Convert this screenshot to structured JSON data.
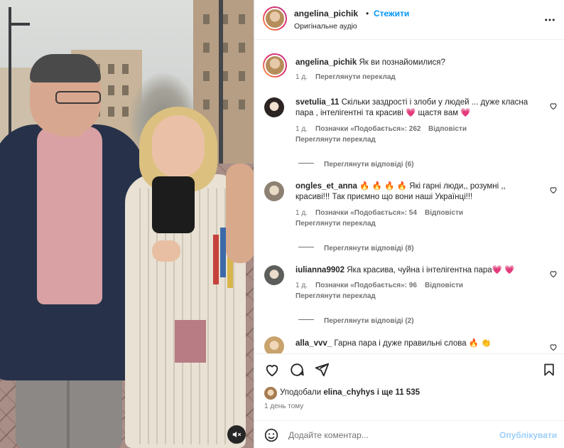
{
  "post_header": {
    "username": "angelina_pichik",
    "separator": "•",
    "follow_label": "Стежити",
    "audio_label": "Оригінальне аудіо",
    "more_icon": "more-horizontal-icon"
  },
  "caption": {
    "username": "angelina_pichik",
    "text": "Як ви познайомилися?",
    "time": "1 д.",
    "translate_label": "Переглянути переклад"
  },
  "comments": [
    {
      "username": "svetulia_11",
      "text": "Скільки заздрості і злоби у людей ... дуже класна пара , інтелігентні та красиві 💗 щастя вам 💗",
      "time": "1 д.",
      "likes_label": "Позначки «Подобається»: 262",
      "reply_label": "Відповісти",
      "translate_label": "Переглянути переклад",
      "view_replies_label": "Переглянути відповіді (6)"
    },
    {
      "username": "ongles_et_anna",
      "text": "🔥 🔥 🔥 🔥 Які гарні люди,, розумні ,, красиві!!! Так приємно що вони наші Українці!!!",
      "time": "1 д.",
      "likes_label": "Позначки «Подобається»: 54",
      "reply_label": "Відповісти",
      "translate_label": "Переглянути переклад",
      "view_replies_label": "Переглянути відповіді (8)"
    },
    {
      "username": "iulianna9902",
      "text": "Яка красива, чуйна і інтелігентна пара💗 💗",
      "time": "1 д.",
      "likes_label": "Позначки «Подобається»: 96",
      "reply_label": "Відповісти",
      "translate_label": "Переглянути переклад",
      "view_replies_label": "Переглянути відповіді (2)"
    },
    {
      "username": "alla_vvv_",
      "text": "Гарна пара і дуже правильні слова 🔥 👏"
    }
  ],
  "actions": {
    "like_icon": "heart-icon",
    "comment_icon": "comment-icon",
    "share_icon": "send-icon",
    "save_icon": "bookmark-icon"
  },
  "likes": {
    "prefix": "Уподобали",
    "user": "elina_chyhys",
    "suffix": "і ще 11 535",
    "time": "1 день тому"
  },
  "comment_box": {
    "emoji_icon": "emoji-icon",
    "placeholder": "Додайте коментар...",
    "post_label": "Опублікувати"
  },
  "media": {
    "mute_icon": "speaker-muted-icon"
  },
  "colors": {
    "link_blue": "#0095f6",
    "post_button_disabled": "#9dcef8",
    "heart_emoji": "#e1306c"
  }
}
